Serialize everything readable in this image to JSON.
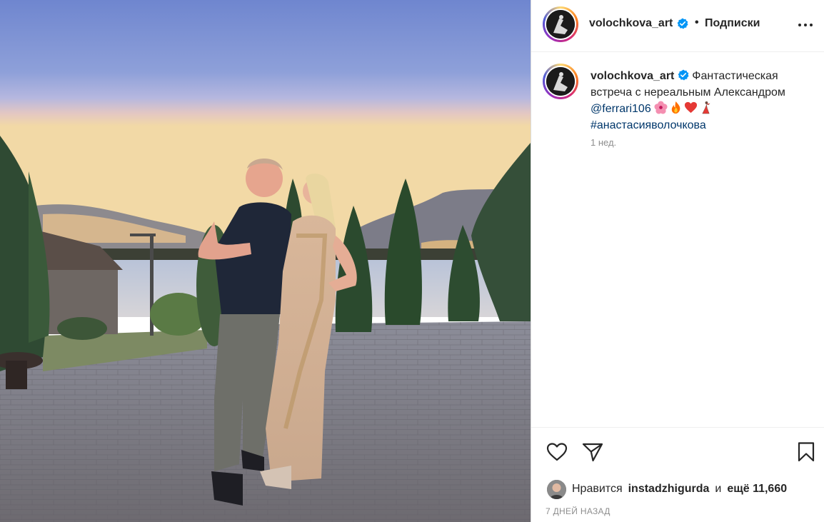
{
  "post": {
    "username": "volochkova_art",
    "follow_label": "Подписки",
    "separator": "•",
    "caption": {
      "username": "volochkova_art",
      "line1": "Фантастическая",
      "line2": "встреча с нереальным Александром",
      "mention": "@ferrari106",
      "hashtag": "#анастасияволочкова",
      "emojis": [
        "hibiscus-icon",
        "fire-icon",
        "heart-icon",
        "dancer-icon"
      ]
    },
    "time_ago": "1 нед.",
    "likes": {
      "prefix": "Нравится",
      "liker": "instadzhigurda",
      "conjunction": "и",
      "rest": "ещё 11,660"
    },
    "date": "7 ДНЕЙ НАЗАД"
  },
  "colors": {
    "link": "#00376b",
    "verified": "#0095f6",
    "muted": "#8e8e8e"
  }
}
